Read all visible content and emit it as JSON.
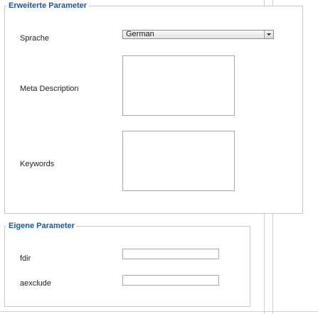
{
  "sections": {
    "advanced": {
      "legend": "Erweiterte Parameter",
      "language_label": "Sprache",
      "language_value": "German",
      "meta_description_label": "Meta Description",
      "meta_description_value": "",
      "keywords_label": "Keywords",
      "keywords_value": ""
    },
    "custom": {
      "legend": "Eigene Parameter",
      "fdir_label": "fdir",
      "fdir_value": "",
      "aexclude_label": "aexclude",
      "aexclude_value": ""
    }
  },
  "colors": {
    "legend": "#1a55a5",
    "border": "#c8c8c8"
  }
}
